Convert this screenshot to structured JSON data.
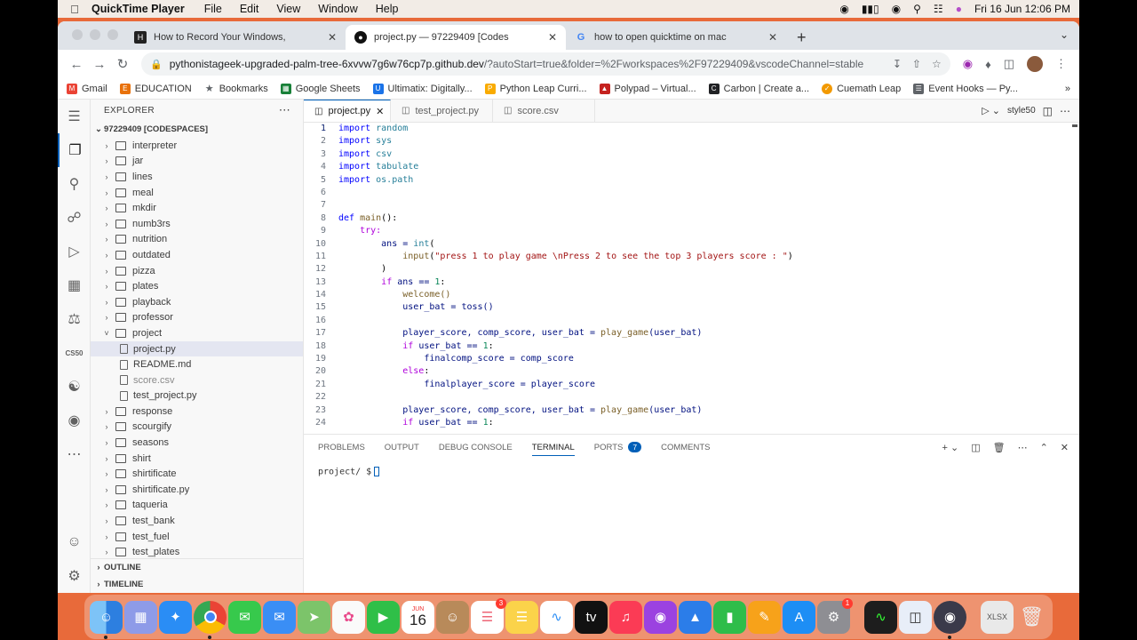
{
  "menubar": {
    "app": "QuickTime Player",
    "items": [
      "File",
      "Edit",
      "View",
      "Window",
      "Help"
    ],
    "datetime": "Fri 16 Jun  12:06 PM"
  },
  "browser": {
    "tabs": [
      {
        "title": "How to Record Your Windows,",
        "favicon": "hig-icon",
        "active": false
      },
      {
        "title": "project.py — 97229409 [Codes",
        "favicon": "github-icon",
        "active": true
      },
      {
        "title": "how to open quicktime on mac",
        "favicon": "google-icon",
        "active": false
      }
    ],
    "url_domain": "pythonistageek-upgraded-palm-tree-6xvvw7g6w76cp7p.github.dev",
    "url_path": "/?autoStart=true&folder=%2Fworkspaces%2F97229409&vscodeChannel=stable",
    "bookmarks": [
      {
        "label": "Gmail",
        "color": "#ea4335"
      },
      {
        "label": "EDUCATION",
        "color": "#e8710a"
      },
      {
        "label": "Bookmarks",
        "color": "#5f6368"
      },
      {
        "label": "Google Sheets",
        "color": "#188038"
      },
      {
        "label": "Ultimatix: Digitally...",
        "color": "#1a73e8"
      },
      {
        "label": "Python Leap Curri...",
        "color": "#f9ab00"
      },
      {
        "label": "Polypad – Virtual...",
        "color": "#c5221f"
      },
      {
        "label": "Carbon | Create a...",
        "color": "#202124"
      },
      {
        "label": "Cuemath Leap",
        "color": "#f29900"
      },
      {
        "label": "Event Hooks — Py...",
        "color": "#5f6368"
      }
    ]
  },
  "vscode": {
    "explorer_title": "EXPLORER",
    "workspace": "97229409 [CODESPACES]",
    "tree": [
      {
        "label": "interpreter",
        "type": "folder"
      },
      {
        "label": "jar",
        "type": "folder"
      },
      {
        "label": "lines",
        "type": "folder"
      },
      {
        "label": "meal",
        "type": "folder"
      },
      {
        "label": "mkdir",
        "type": "folder"
      },
      {
        "label": "numb3rs",
        "type": "folder"
      },
      {
        "label": "nutrition",
        "type": "folder"
      },
      {
        "label": "outdated",
        "type": "folder"
      },
      {
        "label": "pizza",
        "type": "folder"
      },
      {
        "label": "plates",
        "type": "folder"
      },
      {
        "label": "playback",
        "type": "folder"
      },
      {
        "label": "professor",
        "type": "folder"
      },
      {
        "label": "project",
        "type": "open-folder"
      },
      {
        "label": "project.py",
        "type": "file",
        "selected": true
      },
      {
        "label": "README.md",
        "type": "file"
      },
      {
        "label": "score.csv",
        "type": "file",
        "dim": true
      },
      {
        "label": "test_project.py",
        "type": "file"
      },
      {
        "label": "response",
        "type": "folder"
      },
      {
        "label": "scourgify",
        "type": "folder"
      },
      {
        "label": "seasons",
        "type": "folder"
      },
      {
        "label": "shirt",
        "type": "folder"
      },
      {
        "label": "shirtificate",
        "type": "folder"
      },
      {
        "label": "shirtificate.py",
        "type": "folder"
      },
      {
        "label": "taqueria",
        "type": "folder"
      },
      {
        "label": "test_bank",
        "type": "folder"
      },
      {
        "label": "test_fuel",
        "type": "folder"
      },
      {
        "label": "test_plates",
        "type": "folder"
      }
    ],
    "outline_label": "OUTLINE",
    "timeline_label": "TIMELINE",
    "editor_tabs": [
      "project.py",
      "test_project.py",
      "score.csv"
    ],
    "run_config": "style50",
    "panel_tabs": [
      "PROBLEMS",
      "OUTPUT",
      "DEBUG CONSOLE",
      "TERMINAL",
      "PORTS",
      "COMMENTS"
    ],
    "ports_count": "7",
    "terminal_prompt": "project/ $"
  },
  "code_lines": [
    "1",
    "2",
    "3",
    "4",
    "5",
    "6",
    "7",
    "8",
    "9",
    "10",
    "11",
    "12",
    "13",
    "14",
    "15",
    "16",
    "17",
    "18",
    "19",
    "20",
    "21",
    "22",
    "23",
    "24"
  ],
  "code": {
    "l1": [
      "import",
      " random"
    ],
    "l2": [
      "import",
      " sys"
    ],
    "l3": [
      "import",
      " csv"
    ],
    "l4": [
      "import",
      " tabulate"
    ],
    "l5": [
      "import",
      " os.path"
    ],
    "l8": [
      "def",
      " main",
      "():"
    ],
    "l9": "    try:",
    "l10a": "        ans = ",
    "l10b": "int",
    "l10c": "(",
    "l11a": "            ",
    "l11b": "input",
    "l11c": "(",
    "l11d": "\"press 1 to play game \\nPress 2 to see the top 3 players score : \"",
    "l11e": ")",
    "l12": "        )",
    "l13a": "        ",
    "l13b": "if",
    "l13c": " ans == ",
    "l13d": "1",
    "l13e": ":",
    "l14": "            welcome()",
    "l15": "            user_bat = toss()",
    "l17a": "            player_score, comp_score, user_bat = ",
    "l17b": "play_game",
    "l17c": "(user_bat)",
    "l18a": "            ",
    "l18b": "if",
    "l18c": " user_bat == ",
    "l18d": "1",
    "l18e": ":",
    "l19": "                finalcomp_score = comp_score",
    "l20a": "            ",
    "l20b": "else",
    "l20c": ":",
    "l21": "                finalplayer_score = player_score",
    "l23a": "            player_score, comp_score, user_bat = ",
    "l23b": "play_game",
    "l23c": "(user_bat)",
    "l24a": "            ",
    "l24b": "if",
    "l24c": " user_bat == ",
    "l24d": "1",
    "l24e": ":"
  },
  "dock": {
    "calendar_month": "JUN",
    "calendar_day": "16",
    "reminders_badge": "3",
    "settings_badge": "1",
    "apps": [
      {
        "name": "finder-icon",
        "color": "#3d8ff0"
      },
      {
        "name": "launchpad-icon",
        "color": "#6c7ae0"
      },
      {
        "name": "safari-icon",
        "color": "#2a8df5"
      },
      {
        "name": "chrome-icon",
        "color": "#e8e8e8"
      },
      {
        "name": "messages-icon",
        "color": "#37c94c"
      },
      {
        "name": "mail-icon",
        "color": "#3a8ef5"
      },
      {
        "name": "maps-icon",
        "color": "#5fb35a"
      },
      {
        "name": "photos-icon",
        "color": "#f5f5f5"
      },
      {
        "name": "facetime-icon",
        "color": "#2fbf48"
      }
    ]
  }
}
